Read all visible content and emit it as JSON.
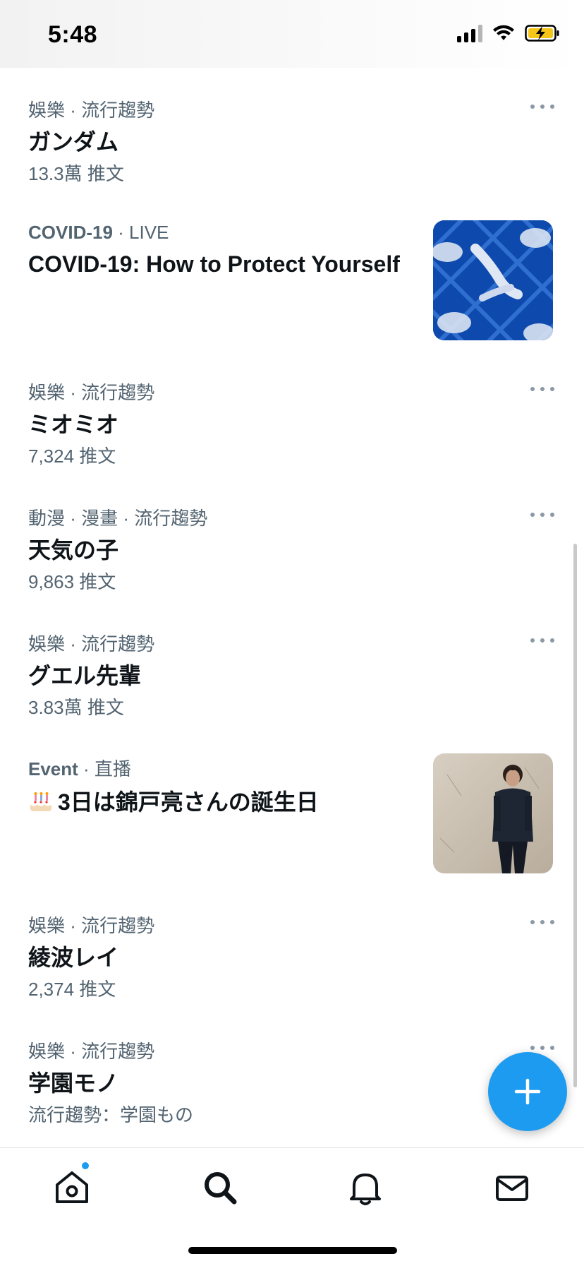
{
  "status_bar": {
    "time": "5:48"
  },
  "trends": [
    {
      "meta": "娛樂 · 流行趨勢",
      "title": "ガンダム",
      "sub": "13.3萬 推文"
    },
    {
      "meta_bold": "COVID-19",
      "meta_rest": " · LIVE",
      "title": "COVID-19: How to Protect Yourself"
    },
    {
      "meta": "娛樂 · 流行趨勢",
      "title": "ミオミオ",
      "sub": "7,324 推文"
    },
    {
      "meta": "動漫 · 漫畫 · 流行趨勢",
      "title": "天気の子",
      "sub": "9,863 推文"
    },
    {
      "meta": "娛樂 · 流行趨勢",
      "title": "グエル先輩",
      "sub": "3.83萬 推文"
    },
    {
      "meta_bold": "Event",
      "meta_rest": " · 直播",
      "title": "3日は錦戸亮さんの誕生日"
    },
    {
      "meta": "娛樂 · 流行趨勢",
      "title": "綾波レイ",
      "sub": "2,374 推文"
    },
    {
      "meta": "娛樂 · 流行趨勢",
      "title": "学園モノ",
      "sub": "流行趨勢：学園もの"
    }
  ],
  "icons": {
    "home": "home-icon",
    "search": "search-icon",
    "notifications": "bell-icon",
    "messages": "mail-icon",
    "compose": "plus-icon"
  },
  "colors": {
    "accent": "#1d9bf0",
    "meta": "#536471"
  }
}
